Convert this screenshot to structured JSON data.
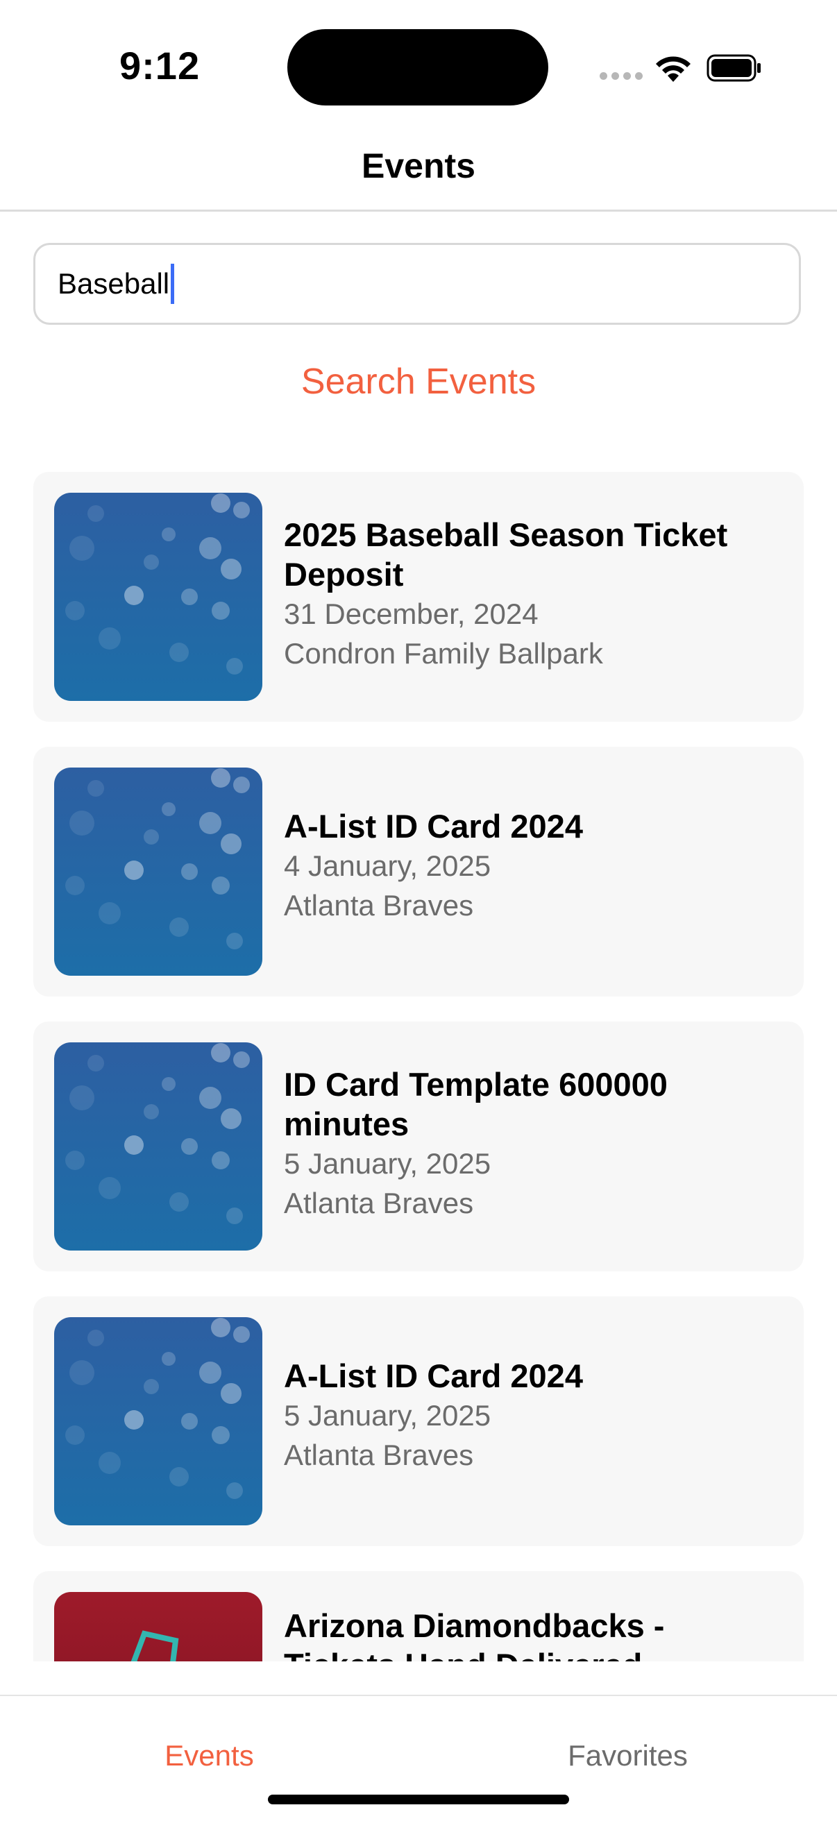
{
  "status": {
    "time": "9:12"
  },
  "nav": {
    "title": "Events"
  },
  "search": {
    "value": "Baseball",
    "button_label": "Search Events"
  },
  "events": [
    {
      "title": "2025 Baseball Season Ticket Deposit",
      "date": "31 December, 2024",
      "venue": "Condron Family Ballpark",
      "image": "blue-bokeh-image"
    },
    {
      "title": "A-List ID Card 2024",
      "date": "4 January, 2025",
      "venue": "Atlanta Braves",
      "image": "blue-bokeh-image"
    },
    {
      "title": "ID Card Template 600000 minutes",
      "date": "5 January, 2025",
      "venue": "Atlanta Braves",
      "image": "blue-bokeh-image"
    },
    {
      "title": "A-List ID Card 2024",
      "date": "5 January, 2025",
      "venue": "Atlanta Braves",
      "image": "blue-bokeh-image"
    },
    {
      "title": "Arizona Diamondbacks - Tickets Hand Delivered",
      "date": "",
      "venue": "",
      "image": "red-diamondbacks-image"
    }
  ],
  "tabs": {
    "events": "Events",
    "favorites": "Favorites"
  },
  "colors": {
    "accent": "#f2603f",
    "card_bg": "#f7f7f7",
    "secondary_text": "#6b6b6b",
    "cursor": "#3b6cf6"
  }
}
